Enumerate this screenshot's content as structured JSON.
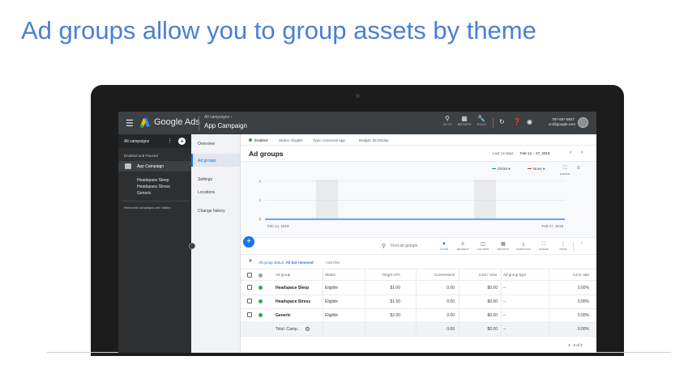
{
  "slide": {
    "title": "Ad groups allow you to group assets by theme"
  },
  "topbar": {
    "brand": "Google Ads",
    "breadcrumb": "All campaigns ›",
    "campaign": "App Campaign",
    "tools": [
      {
        "icon": "search-icon",
        "label": "GO TO"
      },
      {
        "icon": "reports-icon",
        "label": "REPORTS"
      },
      {
        "icon": "wrench-icon",
        "label": "TOOLS"
      }
    ],
    "account_id": "797-097-9847",
    "account_email": "crr@google.com"
  },
  "sidebar": {
    "header": "All campaigns",
    "section": "Enabled and Paused",
    "campaign": "App Campaign",
    "ad_groups": [
      "Headspace Sleep",
      "Headspace Stress",
      "Generic"
    ],
    "hidden_note": "Removed campaigns are hidden"
  },
  "nav": {
    "items": [
      "Overview",
      "Ad groups",
      "Settings",
      "Locations",
      "Change history"
    ],
    "active": "Ad groups"
  },
  "status": {
    "enabled": "Enabled",
    "status": "Status: Eligible",
    "type": "Type: Universal app",
    "budget": "Budget: $2.00/day"
  },
  "page": {
    "title": "Ad groups",
    "date_label": "Last 14 days",
    "date_range": "Feb 14 – 27, 2019"
  },
  "chart_controls": {
    "metric1": "Clicks",
    "metric2": "None",
    "expand_label": "EXPAND",
    "metric1_color": "#1a73e8",
    "metric2_color": "#d93025"
  },
  "chart_data": {
    "type": "line",
    "x": [
      "Feb 14, 2019",
      "Feb 27, 2019"
    ],
    "series": [
      {
        "name": "Clicks",
        "values": [
          0,
          0
        ]
      }
    ],
    "y_ticks": [
      "2",
      "1",
      "0"
    ],
    "ylim": [
      0,
      2
    ],
    "x_tick_labels": [
      "Feb 14, 2019",
      "Feb 27, 2019"
    ],
    "grid": true
  },
  "toolbar": {
    "search_placeholder": "Find ad groups",
    "tools": [
      {
        "icon": "filter-icon",
        "label": "FILTER"
      },
      {
        "icon": "segment-icon",
        "label": "SEGMENT"
      },
      {
        "icon": "columns-icon",
        "label": "COLUMNS"
      },
      {
        "icon": "reports-icon",
        "label": "REPORTS"
      },
      {
        "icon": "download-icon",
        "label": "DOWNLOAD"
      },
      {
        "icon": "expand-icon",
        "label": "EXPAND"
      },
      {
        "icon": "more-icon",
        "label": "MORE"
      }
    ]
  },
  "filter": {
    "prefix": "All group status:",
    "value": "All but removed",
    "add": "Add filter"
  },
  "table": {
    "headers": [
      "Ad group",
      "Status",
      "Target CPA",
      "Conversions",
      "Cost / conv.",
      "Ad group type",
      "Conv. rate"
    ],
    "rows": [
      {
        "name": "Headspace Sleep",
        "status": "Eligible",
        "target_cpa": "$1.00",
        "conversions": "0.00",
        "cost_conv": "$0.00",
        "type": "--",
        "conv_rate": "0.00%"
      },
      {
        "name": "Headspace Stress",
        "status": "Eligible",
        "target_cpa": "$1.50",
        "conversions": "0.00",
        "cost_conv": "$0.00",
        "type": "--",
        "conv_rate": "0.00%"
      },
      {
        "name": "Generic",
        "status": "Eligible",
        "target_cpa": "$2.00",
        "conversions": "0.00",
        "cost_conv": "$0.00",
        "type": "--",
        "conv_rate": "0.00%"
      }
    ],
    "total": {
      "label": "Total: Camp...",
      "conversions": "0.00",
      "cost_conv": "$0.00",
      "type": "--",
      "conv_rate": "0.00%"
    },
    "pager": "1 - 2 of 2"
  }
}
